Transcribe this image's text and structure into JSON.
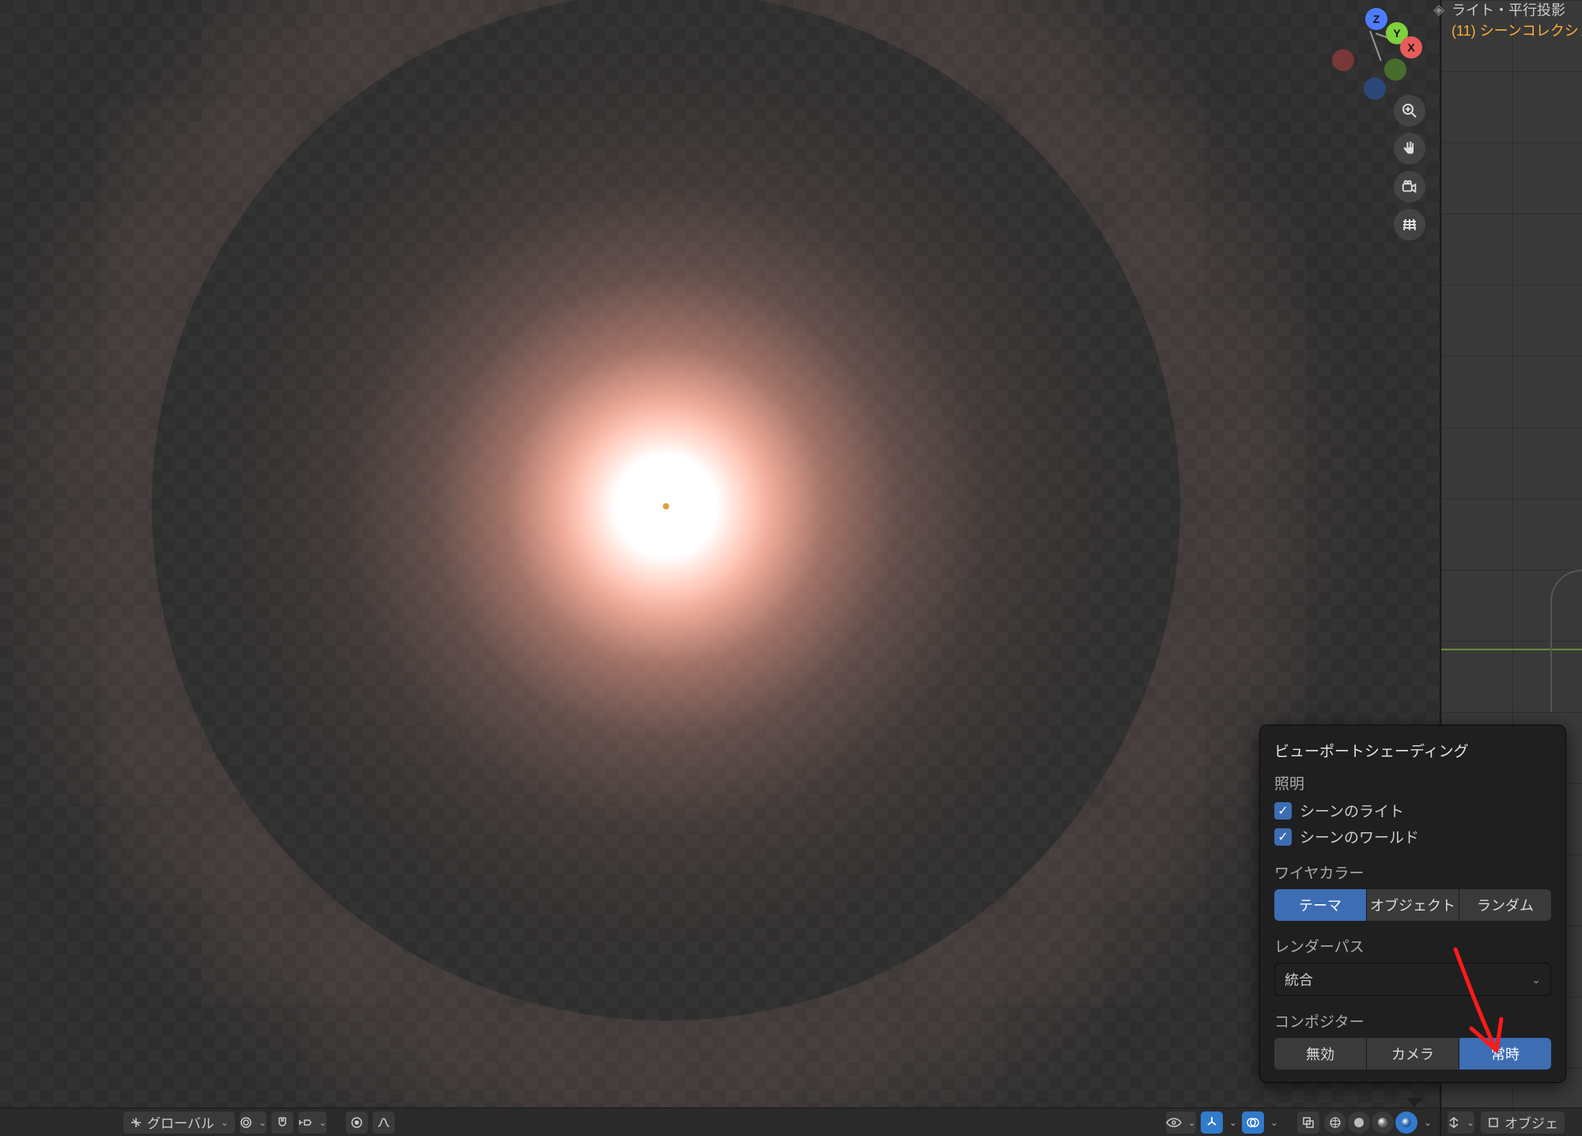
{
  "overlay": {
    "line1": "ライト・平行投影",
    "line2_prefix": "(11) ",
    "line2_text": "シーンコレクショ"
  },
  "gizmo": {
    "x": "X",
    "y": "Y",
    "z": "Z"
  },
  "nav_buttons": {
    "zoom": "zoom-icon",
    "pan": "hand-icon",
    "camera": "camera-icon",
    "grid": "grid-icon"
  },
  "popover": {
    "title": "ビューポートシェーディング",
    "lighting_label": "照明",
    "scene_lights_label": "シーンのライト",
    "scene_world_label": "シーンのワールド",
    "wire_color_label": "ワイヤカラー",
    "wire_options": {
      "theme": "テーマ",
      "object": "オブジェクト",
      "random": "ランダム"
    },
    "render_pass_label": "レンダーパス",
    "render_pass_value": "統合",
    "compositor_label": "コンポジター",
    "compositor_options": {
      "disabled": "無効",
      "camera": "カメラ",
      "always": "常時"
    }
  },
  "footer_left": {
    "orientation_label": "グローバル"
  },
  "footer_right2": {
    "label": "オブジェ"
  }
}
